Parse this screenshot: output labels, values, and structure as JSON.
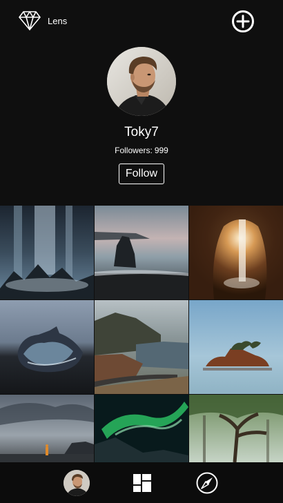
{
  "app": {
    "name": "Lens",
    "logo_icon": "diamond-icon",
    "add_icon": "plus-circle-icon"
  },
  "profile": {
    "username": "Toky7",
    "followers_label": "Followers:",
    "followers_count": "999",
    "follow_button": "Follow"
  },
  "photos": [
    {
      "subject": "waterfall over black rocks"
    },
    {
      "subject": "sea stack on black sand beach"
    },
    {
      "subject": "cave with waterfall"
    },
    {
      "subject": "ice block on black beach"
    },
    {
      "subject": "coastal cliffs with road"
    },
    {
      "subject": "rocky islet in calm sea"
    },
    {
      "subject": "person on rocky shore under clouds"
    },
    {
      "subject": "green aurora over mountain"
    },
    {
      "subject": "misty forest tree"
    }
  ],
  "bottom_nav": {
    "items": [
      {
        "id": "profile",
        "icon": "avatar-icon"
      },
      {
        "id": "grid",
        "icon": "grid-icon"
      },
      {
        "id": "explore",
        "icon": "compass-icon"
      }
    ]
  },
  "colors": {
    "background": "#0f0f0f",
    "text": "#ffffff"
  }
}
